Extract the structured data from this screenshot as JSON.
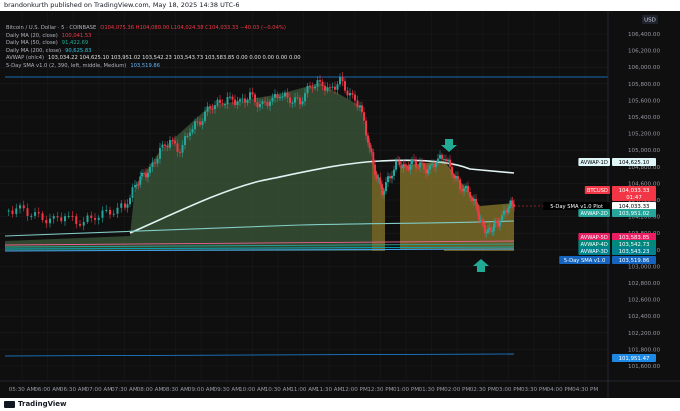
{
  "header": {
    "published_by": "brandonkurth published on TradingView.com, May 18, 2025 14:38 UTC-6"
  },
  "footer": {
    "brand": "TradingView"
  },
  "legend": {
    "symbol": "Bitcoin / U.S. Dollar · 5 · COINBASE",
    "ohlc": "O104,075.36  H104,080.00  L104,024.38  C104,033.33  −40.03 (−0.04%)",
    "rows": [
      {
        "label": "Daily MA (20, close)",
        "value": "100,041.53"
      },
      {
        "label": "Daily MA (50, close)",
        "value": "91,422.69"
      },
      {
        "label": "Daily MA (200, close)",
        "value": "90,625.83"
      },
      {
        "label": "AVWAP (ohlc4)",
        "value": "103,034.22  104,625.10  103,951.02  103,542.23  103,543.73  103,583.85  0.00  0.00  0.00  0.00  0.00"
      },
      {
        "label": "5-Day SMA v1.0 (2, 390, left, middle, Medium)",
        "value": "103,519.86"
      }
    ]
  },
  "currency_badge": "USD",
  "price_axis": {
    "labels": [
      "106,400.00",
      "106,200.00",
      "106,000.00",
      "105,800.00",
      "105,600.00",
      "105,400.00",
      "105,200.00",
      "105,000.00",
      "104,800.00",
      "104,600.00",
      "104,400.00",
      "104,200.00",
      "103,800.00",
      "103,400.00",
      "103,000.00",
      "102,800.00",
      "102,600.00",
      "102,400.00",
      "102,200.00",
      "101,800.00",
      "101,600.00"
    ],
    "tags": [
      {
        "text": "104,625.10",
        "color": "#e0f7fa",
        "fg": "#000000"
      },
      {
        "text": "104,033.33",
        "color": "#f23645",
        "fg": "#ffffff"
      },
      {
        "text": "01:47",
        "color": "#f23645",
        "fg": "#ffffff"
      },
      {
        "text": "104,033.33",
        "color": "#ffffff",
        "fg": "#000000"
      },
      {
        "text": "103,951.02",
        "color": "#26a69a",
        "fg": "#ffffff"
      },
      {
        "text": "103,583.85",
        "color": "#e91e63",
        "fg": "#ffffff"
      },
      {
        "text": "103,542.73",
        "color": "#00897b",
        "fg": "#ffffff"
      },
      {
        "text": "103,543.23",
        "color": "#00838f",
        "fg": "#ffffff"
      },
      {
        "text": "103,519.86",
        "color": "#1565c0",
        "fg": "#ffffff"
      },
      {
        "text": "101,951.47",
        "color": "#1e88e5",
        "fg": "#ffffff"
      }
    ],
    "line_labels": [
      {
        "text": "AVWAP-1D",
        "color": "#e0f7fa",
        "fg": "#000000"
      },
      {
        "text": "BTCUSD",
        "color": "#f23645",
        "fg": "#ffffff"
      },
      {
        "text": "5-Day SMA v1.0 Plot",
        "color": "#000000",
        "fg": "#ffffff"
      },
      {
        "text": "AVWAP-2D",
        "color": "#26a69a",
        "fg": "#ffffff"
      },
      {
        "text": "AVWAP-5D",
        "color": "#e91e63",
        "fg": "#ffffff"
      },
      {
        "text": "AVWAP-4D",
        "color": "#00897b",
        "fg": "#ffffff"
      },
      {
        "text": "AVWAP-3D",
        "color": "#00838f",
        "fg": "#ffffff"
      },
      {
        "text": "5-Day SMA v1.0",
        "color": "#1565c0",
        "fg": "#ffffff"
      }
    ]
  },
  "time_axis": [
    "05:30 AM",
    "06:00 AM",
    "06:30 AM",
    "07:00 AM",
    "07:30 AM",
    "08:00 AM",
    "08:30 AM",
    "09:00 AM",
    "09:30 AM",
    "10:00 AM",
    "10:30 AM",
    "11:00 AM",
    "11:30 AM",
    "12:00 PM",
    "12:30 PM",
    "01:00 PM",
    "01:30 PM",
    "02:00 PM",
    "02:30 PM",
    "03:00 PM",
    "03:30 PM",
    "04:00 PM",
    "04:30 PM"
  ],
  "colors": {
    "up": "#26a69a",
    "down": "#f23645",
    "fill_green": "#3e5a3a",
    "fill_orange": "#8a7a2c",
    "arrow": "#22ab94"
  }
}
